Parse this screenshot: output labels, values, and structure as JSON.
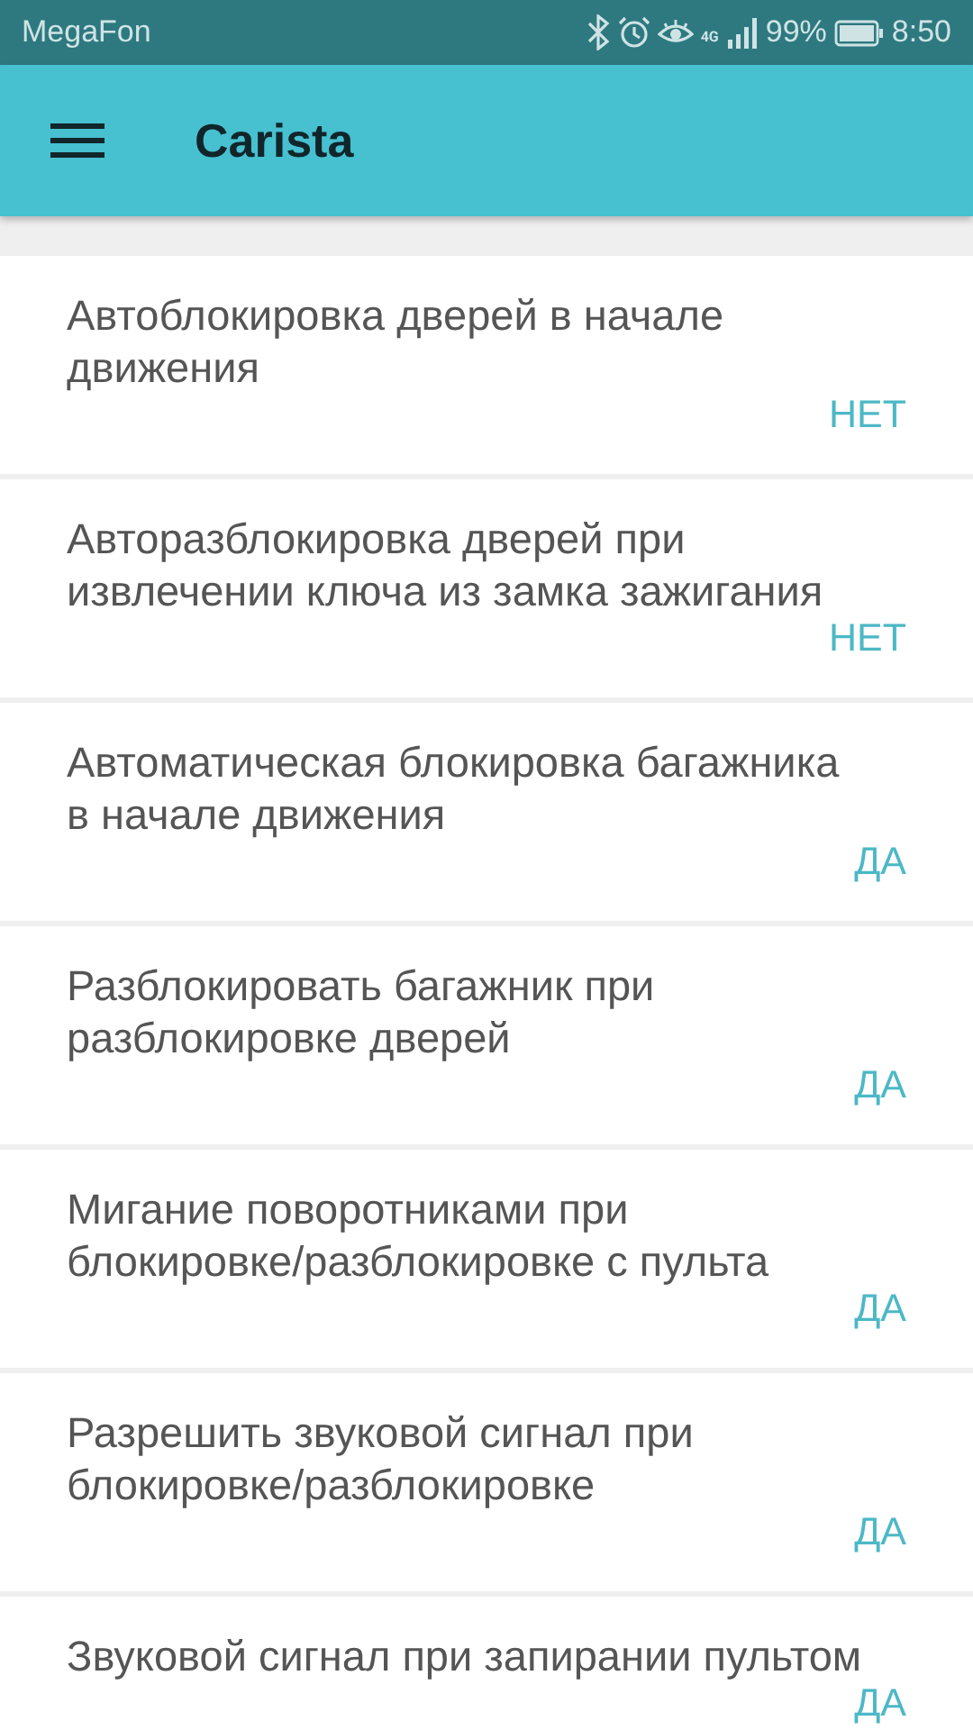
{
  "status_bar": {
    "carrier": "MegaFon",
    "network": "4G",
    "battery": "99%",
    "time": "8:50"
  },
  "toolbar": {
    "title": "Carista"
  },
  "settings": [
    {
      "label": "Автоблокировка дверей в начале движения",
      "value": "НЕТ"
    },
    {
      "label": "Авторазблокировка дверей при извлечении ключа из замка зажигания",
      "value": "НЕТ"
    },
    {
      "label": "Автоматическая блокировка багажника в начале движения",
      "value": "ДА"
    },
    {
      "label": "Разблокировать багажник при разблокировке дверей",
      "value": "ДА"
    },
    {
      "label": "Мигание поворотниками при блокировке/разблокировке с пульта",
      "value": "ДА"
    },
    {
      "label": "Разрешить звуковой сигнал при блокировке/разблокировке",
      "value": "ДА"
    },
    {
      "label": "Звуковой сигнал при запирании пультом",
      "value": "ДА"
    }
  ]
}
